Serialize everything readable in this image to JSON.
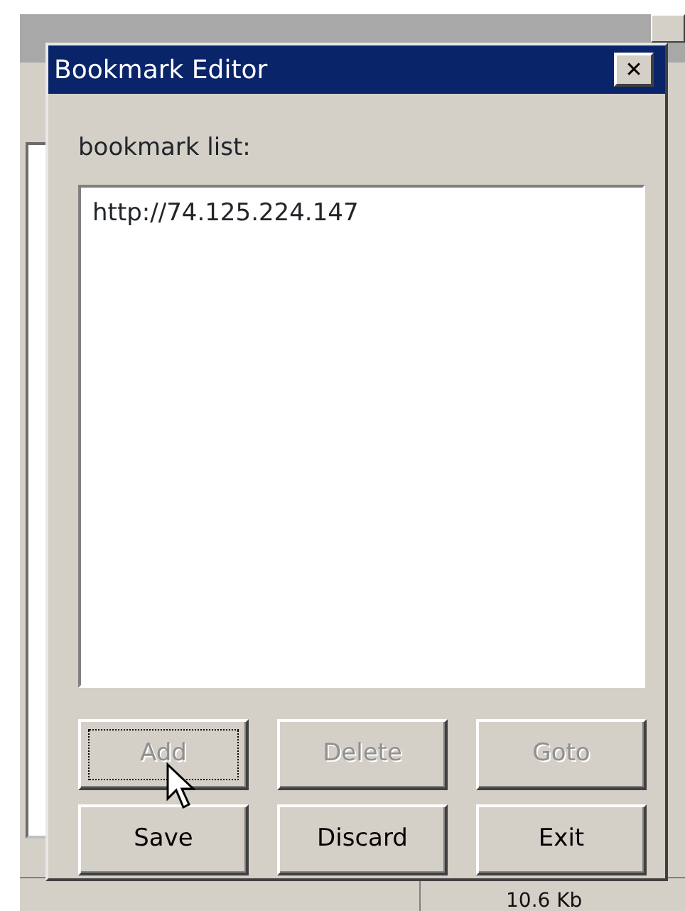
{
  "background_window": {
    "status_bar": {
      "size": "10.6 Kb"
    }
  },
  "dialog": {
    "title": "Bookmark Editor",
    "close": "✕",
    "list_label": "bookmark list:",
    "bookmarks": [
      {
        "url": "http://74.125.224.147",
        "selected": false
      }
    ],
    "buttons": [
      {
        "label": "Add",
        "disabled": true,
        "focused": true
      },
      {
        "label": "Delete",
        "disabled": true,
        "focused": false
      },
      {
        "label": "Goto",
        "disabled": true,
        "focused": false
      },
      {
        "label": "Save",
        "disabled": false,
        "focused": false
      },
      {
        "label": "Discard",
        "disabled": false,
        "focused": false
      },
      {
        "label": "Exit",
        "disabled": false,
        "focused": false
      }
    ]
  }
}
